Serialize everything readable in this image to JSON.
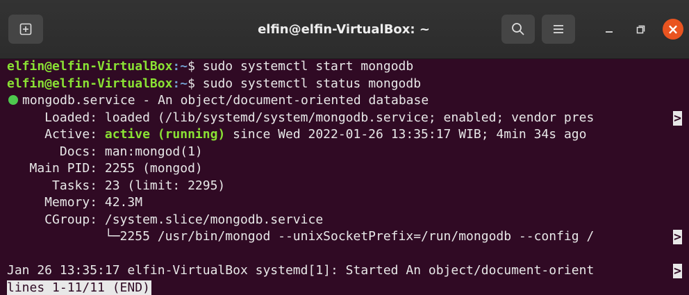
{
  "window": {
    "title": "elfin@elfin-VirtualBox: ~",
    "close_glyph": "×"
  },
  "prompt": {
    "user_host": "elfin@elfin-VirtualBox",
    "path": ":~",
    "symbol": "$ "
  },
  "commands": [
    "sudo systemctl start mongodb",
    "sudo systemctl status mongodb"
  ],
  "status": {
    "unit_line": "mongodb.service - An object/document-oriented database",
    "loaded": "     Loaded: loaded (/lib/systemd/system/mongodb.service; enabled; vendor pres",
    "active_label": "     Active: ",
    "active_state": "active (running)",
    "active_rest": " since Wed 2022-01-26 13:35:17 WIB; 4min 34s ago",
    "docs": "       Docs: man:mongod(1)",
    "main_pid": "   Main PID: 2255 (mongod)",
    "tasks": "      Tasks: 23 (limit: 2295)",
    "memory": "     Memory: 42.3M",
    "cgroup": "     CGroup: /system.slice/mongodb.service",
    "cgroup_child": "             └─2255 /usr/bin/mongod --unixSocketPrefix=/run/mongodb --config /",
    "log": "Jan 26 13:35:17 elfin-VirtualBox systemd[1]: Started An object/document-orient",
    "pager": "lines 1-11/11 (END)",
    "truncate_marker": ">"
  },
  "colors": {
    "background": "#300a24",
    "prompt_user": "#8ae234",
    "prompt_path": "#729fcf",
    "active_state": "#8ae234",
    "status_dot": "#4ec94e",
    "close_button": "#e95420"
  }
}
